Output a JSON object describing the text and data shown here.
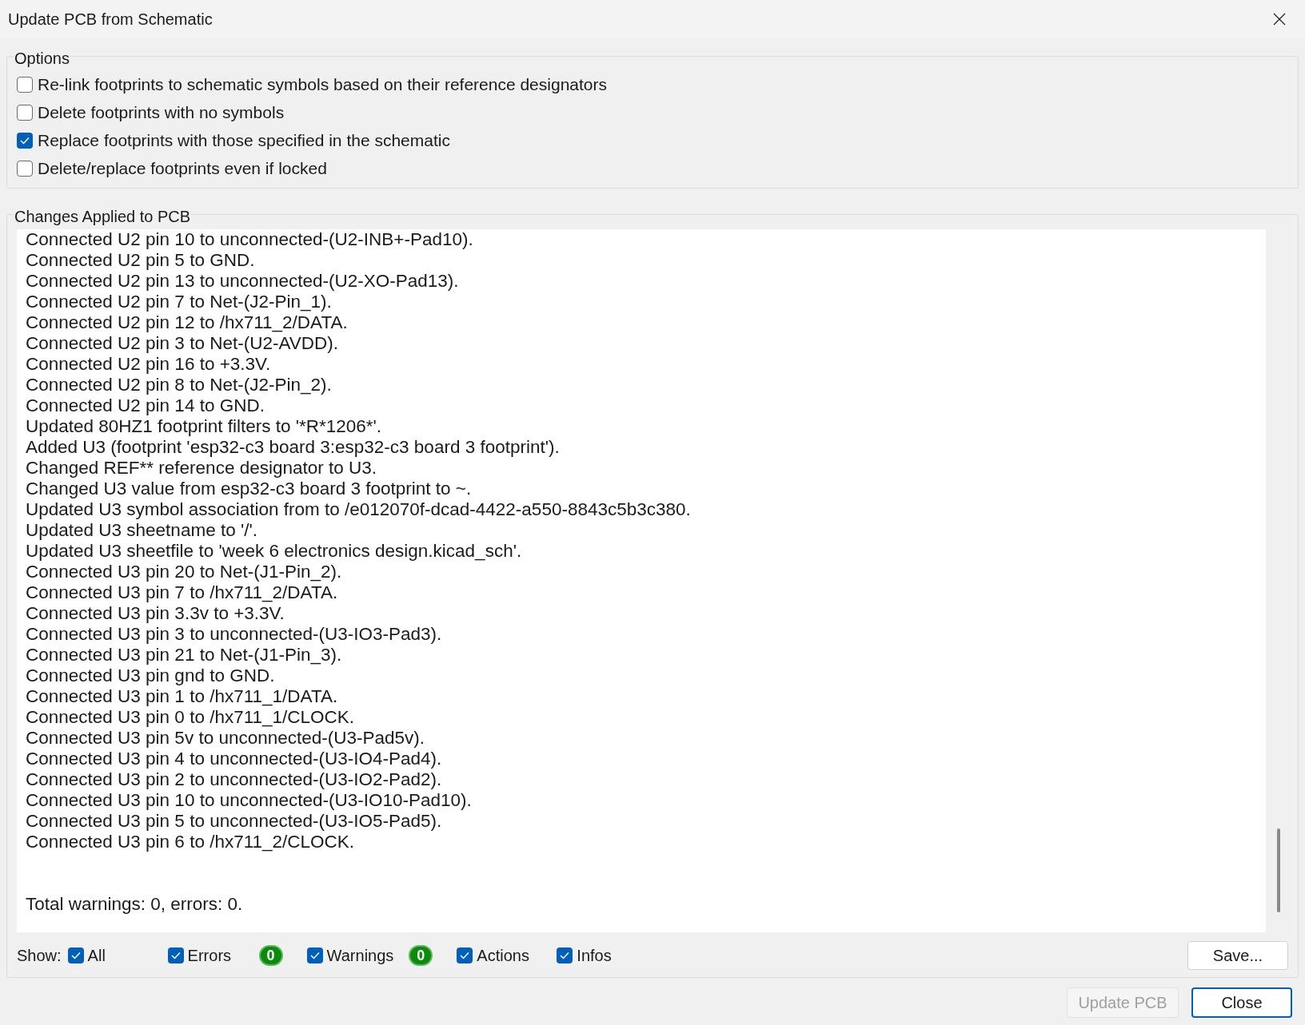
{
  "window": {
    "title": "Update PCB from Schematic"
  },
  "options": {
    "title": "Options",
    "items": [
      {
        "label": "Re-link footprints to schematic symbols based on their reference designators",
        "checked": false
      },
      {
        "label": "Delete footprints with no symbols",
        "checked": false
      },
      {
        "label": "Replace footprints with those specified in the schematic",
        "checked": true
      },
      {
        "label": "Delete/replace footprints even if locked",
        "checked": false
      }
    ]
  },
  "changes": {
    "title": "Changes Applied to PCB",
    "log": [
      "Connected U2 pin 10 to unconnected-(U2-INB+-Pad10).",
      "Connected U2 pin 5 to GND.",
      "Connected U2 pin 13 to unconnected-(U2-XO-Pad13).",
      "Connected U2 pin 7 to Net-(J2-Pin_1).",
      "Connected U2 pin 12 to /hx711_2/DATA.",
      "Connected U2 pin 3 to Net-(U2-AVDD).",
      "Connected U2 pin 16 to +3.3V.",
      "Connected U2 pin 8 to Net-(J2-Pin_2).",
      "Connected U2 pin 14 to GND.",
      "Updated 80HZ1 footprint filters to '*R*1206*'.",
      "Added U3 (footprint 'esp32-c3 board 3:esp32-c3 board 3 footprint').",
      "Changed REF** reference designator to U3.",
      "Changed U3 value from esp32-c3 board 3 footprint to ~.",
      "Updated U3 symbol association from  to /e012070f-dcad-4422-a550-8843c5b3c380.",
      "Updated U3 sheetname to '/'.",
      "Updated U3 sheetfile to 'week 6 electronics design.kicad_sch'.",
      "Connected U3 pin 20 to Net-(J1-Pin_2).",
      "Connected U3 pin 7 to /hx711_2/DATA.",
      "Connected U3 pin 3.3v to +3.3V.",
      "Connected U3 pin 3 to unconnected-(U3-IO3-Pad3).",
      "Connected U3 pin 21 to Net-(J1-Pin_3).",
      "Connected U3 pin gnd to GND.",
      "Connected U3 pin 1 to /hx711_1/DATA.",
      "Connected U3 pin 0 to /hx711_1/CLOCK.",
      "Connected U3 pin 5v to unconnected-(U3-Pad5v).",
      "Connected U3 pin 4 to unconnected-(U3-IO4-Pad4).",
      "Connected U3 pin 2 to unconnected-(U3-IO2-Pad2).",
      "Connected U3 pin 10 to unconnected-(U3-IO10-Pad10).",
      "Connected U3 pin 5 to unconnected-(U3-IO5-Pad5).",
      "Connected U3 pin 6 to /hx711_2/CLOCK."
    ],
    "summary": "Total warnings: 0, errors: 0.",
    "show_label": "Show:",
    "filters": [
      {
        "label": "All",
        "checked": true
      },
      {
        "label": "Errors",
        "checked": true,
        "count": "0"
      },
      {
        "label": "Warnings",
        "checked": true,
        "count": "0"
      },
      {
        "label": "Actions",
        "checked": true
      },
      {
        "label": "Infos",
        "checked": true
      }
    ],
    "save_button": "Save..."
  },
  "buttons": [
    {
      "label": "Update PCB",
      "disabled": true
    },
    {
      "label": "Close",
      "disabled": false
    }
  ]
}
